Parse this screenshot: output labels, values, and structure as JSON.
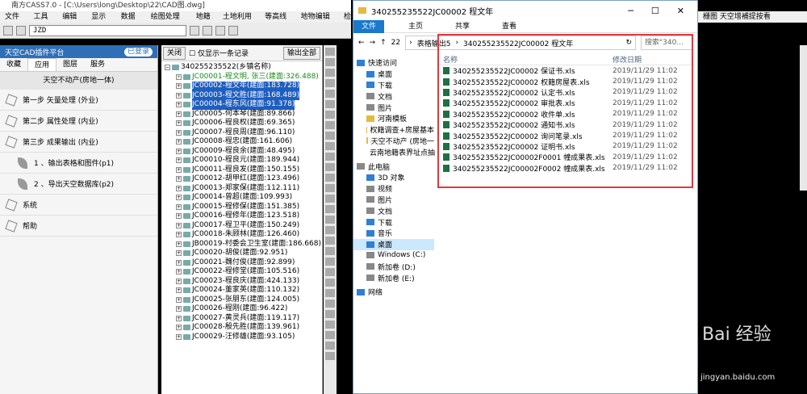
{
  "cad": {
    "title": "南方CASS7.0 - [C:\\Users\\long\\Desktop\\22\\CAD图.dwg]",
    "menu": [
      "文件(F)",
      "工具(T)",
      "编辑(E)",
      "显示(V)",
      "数据(D)",
      "绘图处理(W)",
      "地籍(J)",
      "土地利用(L)",
      "等高线(S)",
      "地物编辑(A)",
      "检"
    ],
    "layer": "JZD",
    "right_menu": "栅图   天空增補提按看"
  },
  "plugin": {
    "header": "天空CAD插件平台",
    "login": "已登录",
    "tabs": [
      "收藏",
      "应用",
      "图层",
      "服务"
    ],
    "active_tab": "应用",
    "section": "天空不动产(房地一体)",
    "items": [
      {
        "label": "第一步 矢量处理 (外业)",
        "type": "arrow"
      },
      {
        "label": "第二步 属性处理 (内业)",
        "type": "arrow"
      },
      {
        "label": "第三步 成果输出 (内业)",
        "type": "arrow"
      },
      {
        "label": "1 、输出表格和图件(p1)",
        "type": "leaf"
      },
      {
        "label": "2 、导出天空数据库(p2)",
        "type": "leaf"
      },
      {
        "label": "系统",
        "type": "arrow"
      },
      {
        "label": "帮助",
        "type": "arrow"
      }
    ]
  },
  "tree": {
    "close": "关闭",
    "only_one_level": "仅显示一条记录",
    "export_all": "输出全部",
    "root": "340255235522(乡镇名称)",
    "rows": [
      {
        "text": "JC00001-程文明, 张三(建面:326.488)",
        "style": "green"
      },
      {
        "text": "JC00002-程文年(建面:183.728)",
        "style": "sel"
      },
      {
        "text": "JC00003-程文胜(建面:168.489)",
        "style": "sel"
      },
      {
        "text": "JC00004-程东风(建面:91.378)",
        "style": "sel"
      },
      {
        "text": "JC00005-何本琴(建面:89.866)",
        "style": ""
      },
      {
        "text": "JC00006-程良权(建面:69.365)",
        "style": ""
      },
      {
        "text": "JC00007-程良周(建面:96.110)",
        "style": ""
      },
      {
        "text": "JC00008-程忠(建面:161.606)",
        "style": ""
      },
      {
        "text": "JC00009-程良余(建面:48.495)",
        "style": ""
      },
      {
        "text": "JC00010-程良元(建面:189.944)",
        "style": ""
      },
      {
        "text": "JC00011-程良发(建面:150.155)",
        "style": ""
      },
      {
        "text": "JC00012-胡甲红(建面:123.496)",
        "style": ""
      },
      {
        "text": "JC00013-郑家保(建面:112.111)",
        "style": ""
      },
      {
        "text": "JC00014-曾超(建面:109.993)",
        "style": ""
      },
      {
        "text": "JC00015-程修保(建面:151.385)",
        "style": ""
      },
      {
        "text": "JC00016-程修年(建面:123.518)",
        "style": ""
      },
      {
        "text": "JC00017-程卫平(建面:150.249)",
        "style": ""
      },
      {
        "text": "JC00018-朱顾林(建面:126.460)",
        "style": ""
      },
      {
        "text": "JB00019-村委会卫生室(建面:186.668)",
        "style": ""
      },
      {
        "text": "JC00020-胡俊(建面:92.951)",
        "style": ""
      },
      {
        "text": "JC00021-魏付俊(建面:92.899)",
        "style": ""
      },
      {
        "text": "JC00022-程修堂(建面:105.516)",
        "style": ""
      },
      {
        "text": "JC00023-程良庆(建面:424.133)",
        "style": ""
      },
      {
        "text": "JC00024-董家英(建面:110.132)",
        "style": ""
      },
      {
        "text": "JC00025-张朋东(建面:124.005)",
        "style": ""
      },
      {
        "text": "JC00026-程刚(建面:96.422)",
        "style": ""
      },
      {
        "text": "JC00027-黄灵兵(建面:119.117)",
        "style": ""
      },
      {
        "text": "JC00028-殷先胜(建面:139.961)",
        "style": ""
      },
      {
        "text": "JC00029-汪修雄(建面:93.105)",
        "style": ""
      }
    ]
  },
  "explorer": {
    "title": "340255235522JC00002 程文年",
    "ribbon": [
      "文件",
      "主页",
      "共享",
      "查看"
    ],
    "path": [
      "表格输出5",
      "340255235522JC00002 程文年"
    ],
    "search_placeholder": "搜索\"340...",
    "path_prefix": "22",
    "col_name": "名称",
    "col_date": "修改日期",
    "sidebar": [
      {
        "label": "快速访问",
        "group": true,
        "icon": "blue"
      },
      {
        "label": "桌面",
        "icon": "blue"
      },
      {
        "label": "下载",
        "icon": "blue"
      },
      {
        "label": "文档",
        "icon": "drive"
      },
      {
        "label": "图片",
        "icon": "drive"
      },
      {
        "label": "河南模板",
        "icon": ""
      },
      {
        "label": "权籍调查+房屋基本",
        "icon": ""
      },
      {
        "label": "天空不动产 (房地一",
        "icon": ""
      },
      {
        "label": "云南地籍表界址点抽",
        "icon": ""
      },
      {
        "label": "此电脑",
        "group": true,
        "icon": "drive"
      },
      {
        "label": "3D 对象",
        "icon": "blue"
      },
      {
        "label": "视频",
        "icon": "drive"
      },
      {
        "label": "图片",
        "icon": "drive"
      },
      {
        "label": "文档",
        "icon": "drive"
      },
      {
        "label": "下载",
        "icon": "blue"
      },
      {
        "label": "音乐",
        "icon": "blue"
      },
      {
        "label": "桌面",
        "icon": "blue",
        "active": true
      },
      {
        "label": "Windows (C:)",
        "icon": "drive"
      },
      {
        "label": "新加卷 (D:)",
        "icon": "drive"
      },
      {
        "label": "新加卷 (E:)",
        "icon": "drive"
      },
      {
        "label": "网络",
        "group": true,
        "icon": "blue"
      }
    ],
    "files": [
      {
        "name": "340255235522JC00002 保证书.xls",
        "date": "2019/11/29 11:02"
      },
      {
        "name": "340255235522JC00002 权籍房屋表.xls",
        "date": "2019/11/29 11:02"
      },
      {
        "name": "340255235522JC00002 认定书.xls",
        "date": "2019/11/29 11:02"
      },
      {
        "name": "340255235522JC00002 审批表.xls",
        "date": "2019/11/29 11:02"
      },
      {
        "name": "340255235522JC00002 收件单.xls",
        "date": "2019/11/29 11:02"
      },
      {
        "name": "340255235522JC00002 通知书.xls",
        "date": "2019/11/29 11:02"
      },
      {
        "name": "340255235522JC00002 询问笔录.xls",
        "date": "2019/11/29 11:02"
      },
      {
        "name": "340255235522JC00002 证明书.xls",
        "date": "2019/11/29 11:02"
      },
      {
        "name": "340255235522JC00002F0001 幢成果表.xls",
        "date": "2019/11/29 11:02"
      },
      {
        "name": "340255235522JC00002F0002 幢成果表.xls",
        "date": "2019/11/29 11:02"
      }
    ]
  },
  "watermark": "Bai 经验",
  "watermark_url": "jingyan.baidu.com",
  "colors": {
    "accent": "#2f6fb8",
    "highlight": "#e0393e",
    "selection": "#1e5ebf"
  }
}
